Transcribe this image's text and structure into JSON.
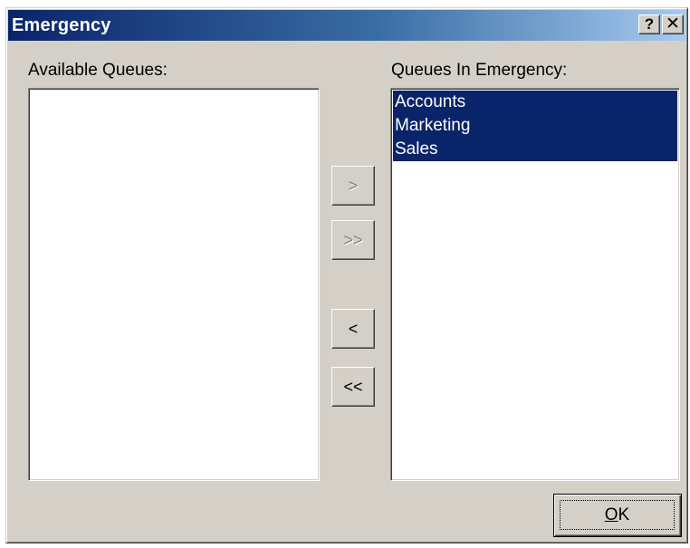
{
  "window": {
    "title": "Emergency",
    "help_label": "?",
    "close_label": "✕"
  },
  "available": {
    "label": "Available Queues:",
    "items": []
  },
  "emergency": {
    "label": "Queues In Emergency:",
    "items": [
      "Accounts",
      "Marketing",
      "Sales"
    ],
    "selected": [
      "Accounts",
      "Marketing",
      "Sales"
    ]
  },
  "buttons": {
    "add": ">",
    "add_all": ">>",
    "remove": "<",
    "remove_all": "<<",
    "add_disabled": true,
    "add_all_disabled": true
  },
  "ok": {
    "mnemonic": "O",
    "rest": "K"
  },
  "colors": {
    "dialog_face": "#d4d0c8",
    "titlebar_start": "#0a246a",
    "titlebar_end": "#a6caf0",
    "selection": "#0a246a",
    "disabled_text": "#808080"
  }
}
